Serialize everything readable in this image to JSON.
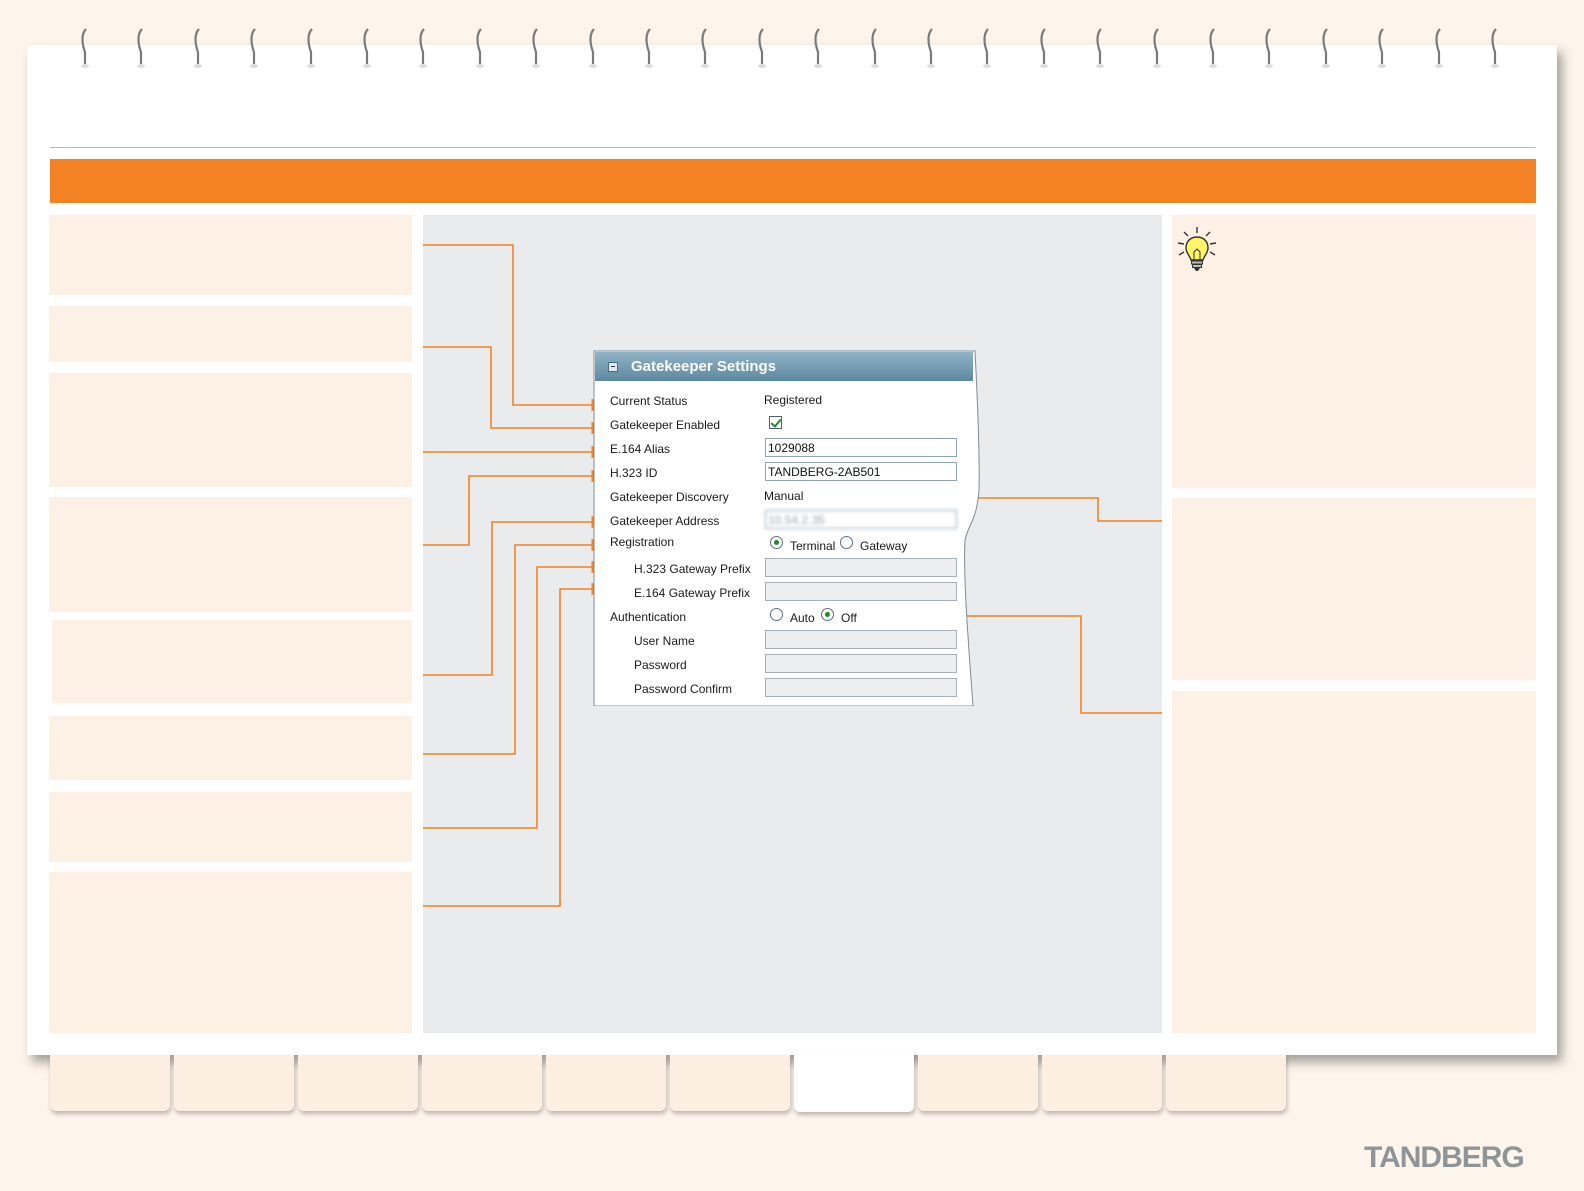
{
  "dialog": {
    "title": "Gatekeeper Settings",
    "rows": {
      "current_status": {
        "label": "Current Status",
        "value": "Registered"
      },
      "gatekeeper_enabled": {
        "label": "Gatekeeper Enabled",
        "checked": true
      },
      "e164_alias": {
        "label": "E.164 Alias",
        "value": "1029088"
      },
      "h323_id": {
        "label": "H.323 ID",
        "value": "TANDBERG-2AB501"
      },
      "gatekeeper_discovery": {
        "label": "Gatekeeper Discovery",
        "value": "Manual"
      },
      "gatekeeper_address": {
        "label": "Gatekeeper Address",
        "value": "10.54.2.35"
      },
      "registration": {
        "label": "Registration",
        "options": [
          "Terminal",
          "Gateway"
        ],
        "selected": "Terminal"
      },
      "h323_gateway_prefix": {
        "label": "H.323 Gateway Prefix",
        "value": ""
      },
      "e164_gateway_prefix": {
        "label": "E.164 Gateway Prefix",
        "value": ""
      },
      "authentication": {
        "label": "Authentication",
        "options": [
          "Auto",
          "Off"
        ],
        "selected": "Off"
      },
      "user_name": {
        "label": "User Name",
        "value": ""
      },
      "password": {
        "label": "Password",
        "value": ""
      },
      "password_confirm": {
        "label": "Password Confirm",
        "value": ""
      }
    }
  },
  "icons": {
    "tip": "lightbulb-icon",
    "collapse": "collapse-icon"
  },
  "colors": {
    "accent": "#f38224",
    "page_bg": "#fdf4ec",
    "panel_bg": "#fdf0e4",
    "dialog_header": "#6f97ad"
  },
  "brand": {
    "logo": "TANDBERG"
  }
}
